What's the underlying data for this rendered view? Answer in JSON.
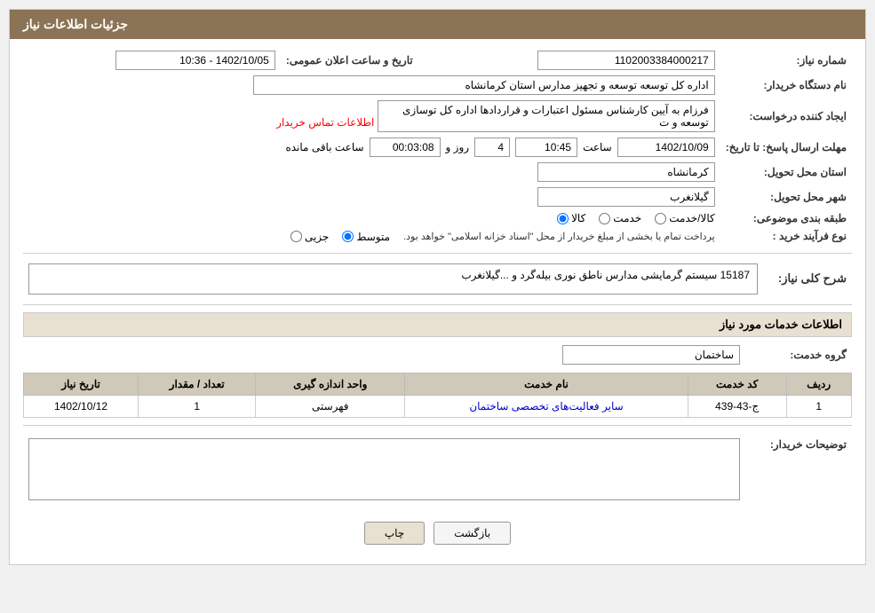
{
  "header": {
    "title": "جزئیات اطلاعات نیاز"
  },
  "fields": {
    "need_number_label": "شماره نیاز:",
    "need_number_value": "1102003384000217",
    "announcement_date_label": "تاریخ و ساعت اعلان عمومی:",
    "announcement_date_value": "1402/10/05 - 10:36",
    "buyer_org_label": "نام دستگاه خریدار:",
    "buyer_org_value": "اداره کل توسعه  توسعه و تجهیز مدارس استان کرمانشاه",
    "creator_label": "ایجاد کننده درخواست:",
    "creator_value": "فرزام به آیین کارشناس مسئول اعتبارات و قراردادها اداره کل توسازی  توسعه و ت",
    "creator_link": "اطلاعات تماس خریدار",
    "response_deadline_label": "مهلت ارسال پاسخ: تا تاریخ:",
    "response_date": "1402/10/09",
    "response_time": "10:45",
    "response_days": "4",
    "response_days_label": "روز و",
    "response_remaining": "00:03:08",
    "response_remaining_label": "ساعت باقی مانده",
    "province_label": "استان محل تحویل:",
    "province_value": "کرمانشاه",
    "city_label": "شهر محل تحویل:",
    "city_value": "گیلانغرب",
    "category_label": "طبقه بندی موضوعی:",
    "category_options": [
      "کالا",
      "خدمت",
      "کالا/خدمت"
    ],
    "category_selected": "کالا",
    "purchase_type_label": "نوع فرآیند خرید :",
    "purchase_type_options": [
      "جزیی",
      "متوسط"
    ],
    "purchase_type_note": "پرداخت تمام یا بخشی از مبلغ خریدار از محل \"اسناد خزانه اسلامی\" خواهد بود.",
    "need_description_label": "شرح کلی نیاز:",
    "need_description_value": "15187 سیستم گرمایشی مدارس ناطق نوری بیله‌گرد و ...گیلانغرب",
    "service_info_label": "اطلاعات خدمات مورد نیاز",
    "service_group_label": "گروه خدمت:",
    "service_group_value": "ساختمان",
    "table": {
      "headers": [
        "ردیف",
        "کد خدمت",
        "نام خدمت",
        "واحد اندازه گیری",
        "تعداد / مقدار",
        "تاریخ نیاز"
      ],
      "rows": [
        {
          "row": "1",
          "service_code": "ج-43-439",
          "service_name": "سایر فعالیت‌های تخصصی ساختمان",
          "unit": "فهرستی",
          "quantity": "1",
          "date": "1402/10/12"
        }
      ]
    },
    "buyer_notes_label": "توضیحات خریدار:",
    "buyer_notes_value": ""
  },
  "buttons": {
    "print_label": "چاپ",
    "back_label": "بازگشت"
  }
}
